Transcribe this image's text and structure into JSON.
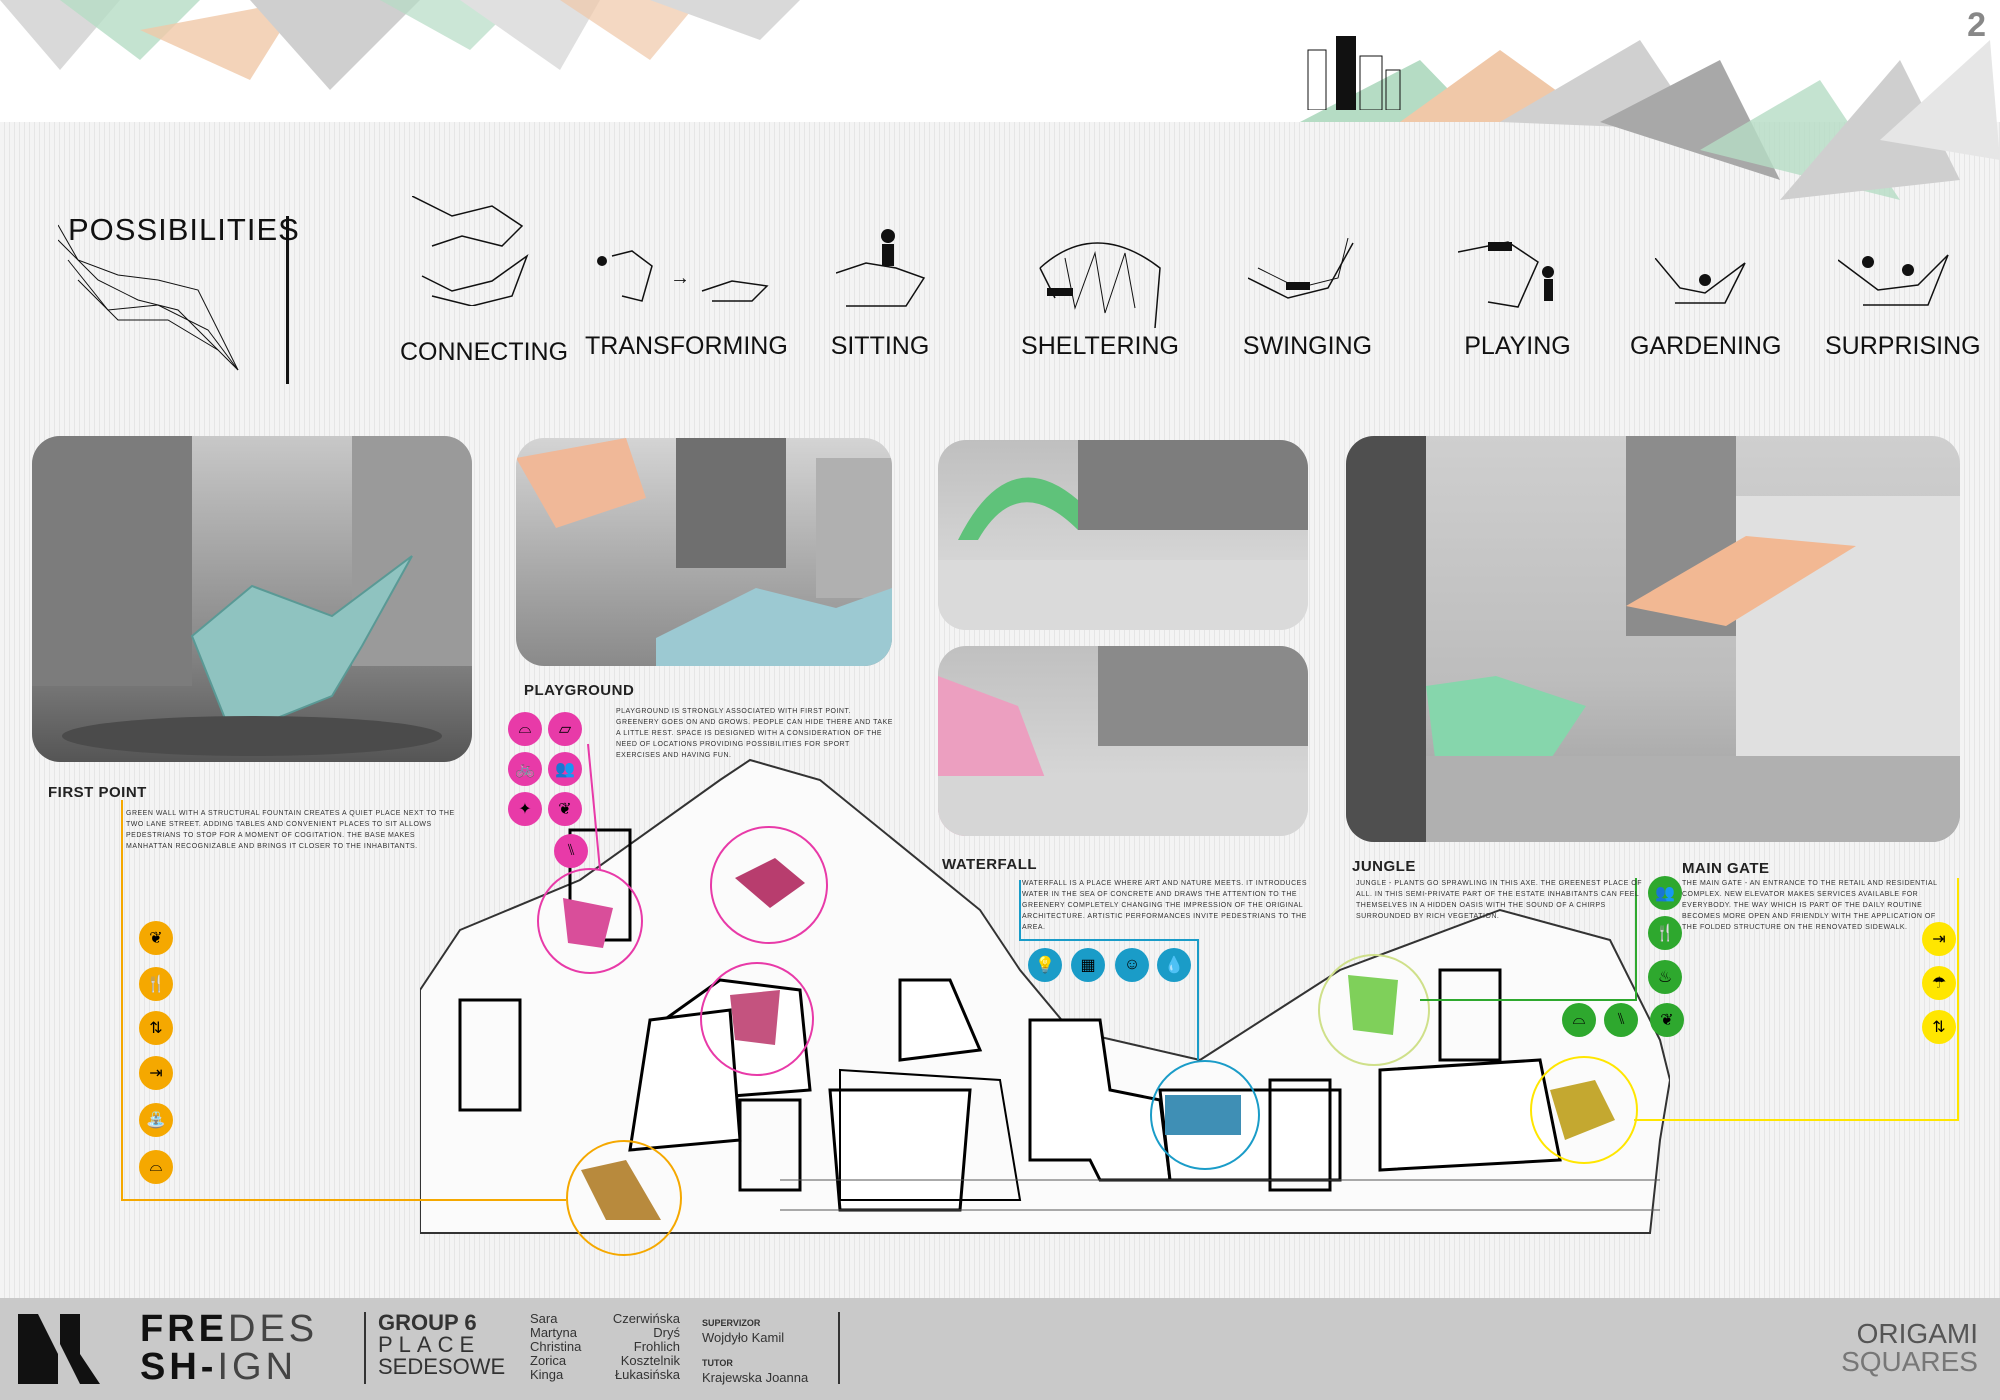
{
  "page_number": "2",
  "possibilities": {
    "title": "POSSIBILITIES",
    "items": [
      {
        "label": "CONNECTING"
      },
      {
        "label": "TRANSFORMING"
      },
      {
        "label": "SITTING"
      },
      {
        "label": "SHELTERING"
      },
      {
        "label": "SWINGING"
      },
      {
        "label": "PLAYING"
      },
      {
        "label": "GARDENING"
      },
      {
        "label": "SURPRISING"
      }
    ]
  },
  "sections": {
    "first_point": {
      "title": "FIRST POINT",
      "text": "GREEN WALL WITH A STRUCTURAL FOUNTAIN CREATES A QUIET PLACE NEXT TO THE TWO LANE STREET. ADDING TABLES AND CONVENIENT PLACES TO SIT ALLOWS PEDESTRIANS TO STOP FOR A MOMENT OF COGITATION. THE BASE MAKES MANHATTAN RECOGNIZABLE AND BRINGS IT CLOSER TO THE INHABITANTS.",
      "color": "#f5a800"
    },
    "playground": {
      "title": "PLAYGROUND",
      "text": "PLAYGROUND IS STRONGLY ASSOCIATED WITH FIRST POINT. GREENERY GOES ON AND GROWS. PEOPLE CAN HIDE THERE AND TAKE A LITTLE REST. SPACE IS DESIGNED WITH A CONSIDERATION OF THE NEED OF LOCATIONS PROVIDING POSSIBILITIES FOR SPORT EXERCISES AND HAVING FUN.",
      "color": "#e83aa8"
    },
    "waterfall": {
      "title": "WATERFALL",
      "text": "WATERFALL IS A PLACE WHERE ART AND NATURE MEETS. IT INTRODUCES WATER IN THE SEA OF CONCRETE AND DRAWS THE ATTENTION TO THE GREENERY COMPLETELY CHANGING THE IMPRESSION OF THE ORIGINAL ARCHITECTURE. ARTISTIC PERFORMANCES INVITE PEDESTRIANS TO THE AREA.",
      "color": "#1a9cc8"
    },
    "jungle": {
      "title": "JUNGLE",
      "text": "JUNGLE - PLANTS GO SPRAWLING IN THIS AXE. THE GREENEST PLACE OF ALL. IN THIS SEMI-PRIVATE PART OF THE ESTATE INHABITANTS CAN FEEL THEMSELVES IN A HIDDEN OASIS WITH THE SOUND OF A CHIRPS SURROUNDED BY RICH VEGETATION.",
      "color": "#2ea82e"
    },
    "main_gate": {
      "title": "MAIN GATE",
      "text": "THE MAIN GATE - AN ENTRANCE TO THE RETAIL AND RESIDENTIAL COMPLEX. NEW ELEVATOR MAKES SERVICES AVAILABLE FOR EVERYBODY. THE WAY WHICH IS PART OF THE DAILY ROUTINE BECOMES MORE OPEN AND FRIENDLY WITH THE APPLICATION OF THE FOLDED STRUCTURE ON THE RENOVATED SIDEWALK.",
      "color": "#ffe600"
    }
  },
  "footer": {
    "brand_line1a": "FRE",
    "brand_line1b": "DES",
    "brand_line2a": "SH-",
    "brand_line2b": "IGN",
    "group": "GROUP 6",
    "place1": "PLACE",
    "place2": "SEDESOWE",
    "members": [
      {
        "first": "Sara",
        "last": "Czerwińska"
      },
      {
        "first": "Martyna",
        "last": "Dryś"
      },
      {
        "first": "Christina",
        "last": "Frohlich"
      },
      {
        "first": "Zorica",
        "last": "Kosztelnik"
      },
      {
        "first": "Kinga",
        "last": "Łukasińska"
      }
    ],
    "supervisor_label": "SUPERVIZOR",
    "supervisor": "Wojdyło Kamil",
    "tutor_label": "TUTOR",
    "tutor": "Krajewska Joanna",
    "project1": "ORIGAMI",
    "project2": "SQUARES"
  }
}
